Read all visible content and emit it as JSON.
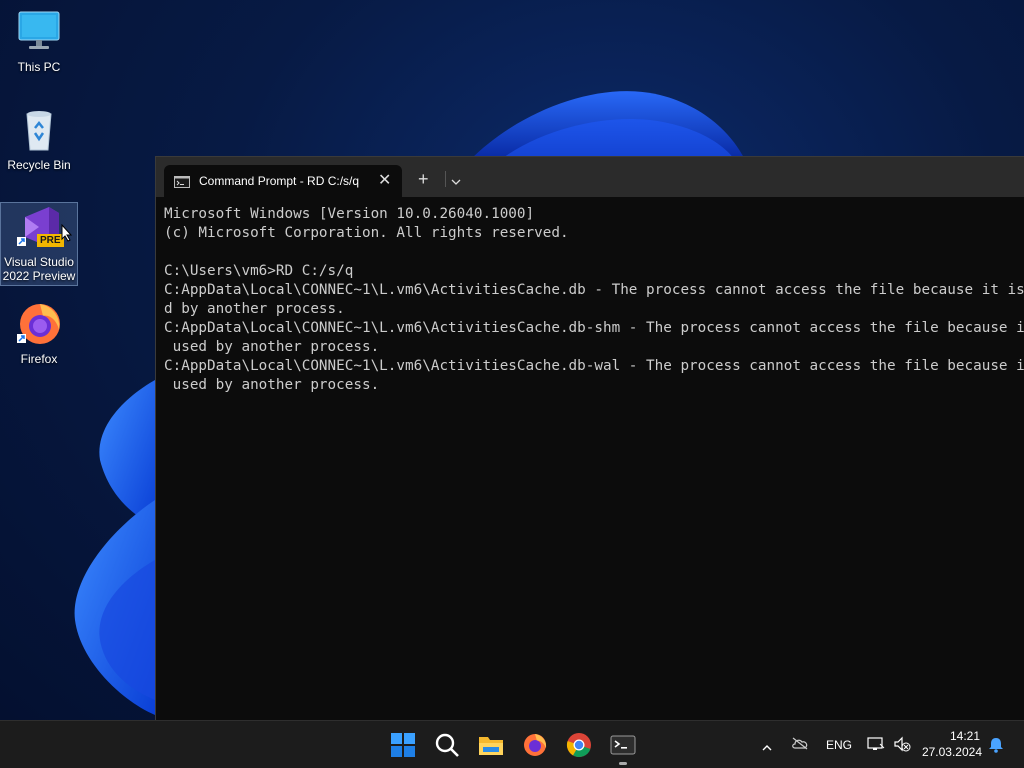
{
  "desktop": {
    "icons": [
      {
        "name": "This PC"
      },
      {
        "name": "Recycle Bin"
      },
      {
        "name": "Visual Studio 2022 Preview",
        "line1": "Visual Studio",
        "line2": "2022 Preview",
        "badge": "PRE"
      },
      {
        "name": "Firefox"
      }
    ]
  },
  "terminal": {
    "tab_title": "Command Prompt - RD  C:/s/q",
    "close_glyph": "✕",
    "new_tab_glyph": "+",
    "lines": [
      "Microsoft Windows [Version 10.0.26040.1000]",
      "(c) Microsoft Corporation. All rights reserved.",
      "",
      "C:\\Users\\vm6>RD C:/s/q",
      "C:AppData\\Local\\CONNEC~1\\L.vm6\\ActivitiesCache.db - The process cannot access the file because it is being use",
      "d by another process.",
      "C:AppData\\Local\\CONNEC~1\\L.vm6\\ActivitiesCache.db-shm - The process cannot access the file because it is being",
      " used by another process.",
      "C:AppData\\Local\\CONNEC~1\\L.vm6\\ActivitiesCache.db-wal - The process cannot access the file because it is being",
      " used by another process."
    ]
  },
  "taskbar": {
    "apps": [
      "start-icon",
      "search-icon",
      "file-explorer-icon",
      "firefox-icon",
      "chrome-icon",
      "terminal-icon"
    ],
    "tray": {
      "language": "ENG",
      "time": "14:21",
      "date": "27.03.2024"
    }
  },
  "colors": {
    "accent": "#0078d4",
    "console_bg": "#0c0c0c",
    "console_fg": "#cccccc",
    "taskbar_bg": "#1c1c1c"
  }
}
